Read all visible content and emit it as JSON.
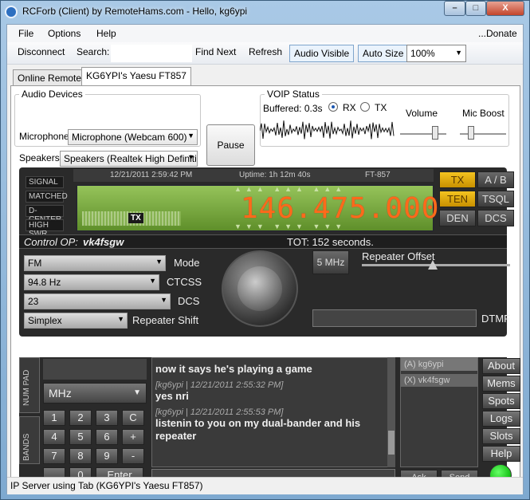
{
  "window": {
    "title": "RCForb (Client) by RemoteHams.com - Hello, kg6ypi",
    "min": "–",
    "max": "□",
    "close": "X"
  },
  "menu": {
    "file": "File",
    "options": "Options",
    "help": "Help",
    "donate": "...Donate"
  },
  "toolbar": {
    "disconnect": "Disconnect",
    "search_label": "Search:",
    "search_value": "",
    "find_next": "Find Next",
    "refresh": "Refresh",
    "audio_visible": "Audio Visible",
    "auto_size": "Auto Size",
    "zoom": "100%"
  },
  "tabs": [
    {
      "label": "Online Remotes"
    },
    {
      "label": "KG6YPI's Yaesu FT857"
    }
  ],
  "audio": {
    "group_title": "Audio Devices",
    "mic_label": "Microphone",
    "mic_value": "Microphone (Webcam 600)",
    "spk_label": "Speakers",
    "spk_value": "Speakers (Realtek High Definiti",
    "pause": "Pause"
  },
  "voip": {
    "group_title": "VOIP Status",
    "buffered": "Buffered: 0.3s",
    "rx": "RX",
    "tx": "TX",
    "volume": "Volume",
    "mic_boost": "Mic Boost",
    "rx_selected": true,
    "volume_level": 0.8,
    "mic_boost_level": 0.2
  },
  "radio": {
    "indicators": [
      "SIGNAL",
      "MATCHED",
      "D-CENTER",
      "HIGH SWR"
    ],
    "datetime": "12/21/2011 2:59:42 PM",
    "uptime": "Uptime: 1h 12m 40s",
    "model": "FT-857",
    "frequency": "146.475.000",
    "tx_badge": "TX",
    "btn_tx": "TX",
    "btn_ab": "A / B",
    "btn_ten": "TEN",
    "btn_tsql": "TSQL",
    "btn_den": "DEN",
    "btn_dcs": "DCS",
    "control_op_label": "Control OP:",
    "control_op": "vk4fsgw",
    "tot": "TOT: 152 seconds.",
    "mode_value": "FM",
    "mode_label": "Mode",
    "ctcss_value": "94.8 Hz",
    "ctcss_label": "CTCSS",
    "dcs_value": "23",
    "dcs_label": "DCS",
    "shift_value": "Simplex",
    "shift_label": "Repeater Shift",
    "step": "5 MHz",
    "offset_label": "Repeater Offset",
    "dtmf_label": "DTMF"
  },
  "keypad": {
    "numpad_tab": "NUM PAD",
    "bands_tab": "BANDS",
    "unit": "MHz",
    "keys": [
      "1",
      "2",
      "3",
      "C",
      "4",
      "5",
      "6",
      "+",
      "7",
      "8",
      "9",
      "-",
      ".",
      "0",
      "Enter"
    ]
  },
  "chat": {
    "messages": [
      {
        "meta": "",
        "text": "now it says he's playing a game"
      },
      {
        "meta": "[kg6ypi | 12/21/2011 2:55:32 PM]",
        "text": "yes nri"
      },
      {
        "meta": "[kg6ypi | 12/21/2011 2:55:53 PM]",
        "text": "listenin to you on my dual-bander and his repeater"
      }
    ],
    "input": ""
  },
  "users": [
    {
      "label": "(A) kg6ypi"
    },
    {
      "label": "(X) vk4fsgw"
    }
  ],
  "user_buttons": {
    "ask": "Ask",
    "send": "Send"
  },
  "side_buttons": [
    "About",
    "Mems",
    "Spots",
    "Logs",
    "Slots",
    "Help"
  ],
  "status": "IP Server using Tab (KG6YPI's Yaesu FT857)",
  "colors": {
    "freq": "#ff6a1a",
    "lcd": "#7fae3a",
    "amber": "#f0b400",
    "led": "#1cc61c"
  }
}
